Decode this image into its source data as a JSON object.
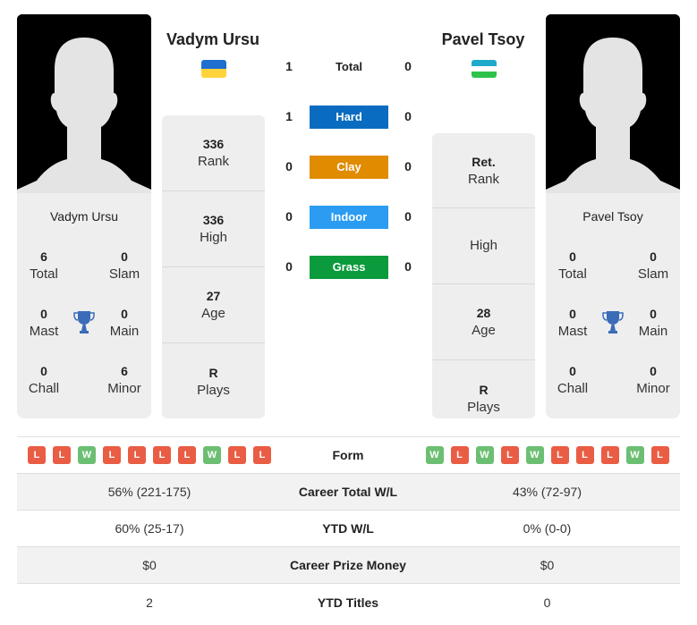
{
  "colors": {
    "hard": "#0a6cc0",
    "clay": "#e08b00",
    "indoor": "#2b9cf2",
    "grass": "#0b9a3c",
    "win": "#6cbf72",
    "loss": "#e95d44",
    "trophy": "#3a6cb8"
  },
  "player1": {
    "name": "Vadym Ursu",
    "flag": "ukraine-flag",
    "card_name": "Vadym Ursu",
    "titles": {
      "total": {
        "value": "6",
        "label": "Total"
      },
      "slam": {
        "value": "0",
        "label": "Slam"
      },
      "mast": {
        "value": "0",
        "label": "Mast"
      },
      "main": {
        "value": "0",
        "label": "Main"
      },
      "chall": {
        "value": "0",
        "label": "Chall"
      },
      "minor": {
        "value": "6",
        "label": "Minor"
      }
    },
    "stats": [
      {
        "value": "336",
        "label": "Rank"
      },
      {
        "value": "336",
        "label": "High"
      },
      {
        "value": "27",
        "label": "Age"
      },
      {
        "value": "R",
        "label": "Plays"
      }
    ],
    "form": [
      "L",
      "L",
      "W",
      "L",
      "L",
      "L",
      "L",
      "W",
      "L",
      "L"
    ]
  },
  "player2": {
    "name": "Pavel Tsoy",
    "flag": "uzbekistan-flag",
    "card_name": "Pavel Tsoy",
    "titles": {
      "total": {
        "value": "0",
        "label": "Total"
      },
      "slam": {
        "value": "0",
        "label": "Slam"
      },
      "mast": {
        "value": "0",
        "label": "Mast"
      },
      "main": {
        "value": "0",
        "label": "Main"
      },
      "chall": {
        "value": "0",
        "label": "Chall"
      },
      "minor": {
        "value": "0",
        "label": "Minor"
      }
    },
    "stats": [
      {
        "value": "Ret.",
        "label": "Rank"
      },
      {
        "value": "",
        "label": "High"
      },
      {
        "value": "28",
        "label": "Age"
      },
      {
        "value": "R",
        "label": "Plays"
      }
    ],
    "form": [
      "W",
      "L",
      "W",
      "L",
      "W",
      "L",
      "L",
      "L",
      "W",
      "L"
    ]
  },
  "h2h": [
    {
      "label": "Total",
      "p1": "1",
      "p2": "0",
      "type": "total"
    },
    {
      "label": "Hard",
      "p1": "1",
      "p2": "0",
      "type": "hard"
    },
    {
      "label": "Clay",
      "p1": "0",
      "p2": "0",
      "type": "clay"
    },
    {
      "label": "Indoor",
      "p1": "0",
      "p2": "0",
      "type": "indoor"
    },
    {
      "label": "Grass",
      "p1": "0",
      "p2": "0",
      "type": "grass"
    }
  ],
  "comparison": {
    "form_label": "Form",
    "rows": [
      {
        "label": "Career Total W/L",
        "p1": "56% (221-175)",
        "p2": "43% (72-97)"
      },
      {
        "label": "YTD W/L",
        "p1": "60% (25-17)",
        "p2": "0% (0-0)"
      },
      {
        "label": "Career Prize Money",
        "p1": "$0",
        "p2": "$0"
      },
      {
        "label": "YTD Titles",
        "p1": "2",
        "p2": "0"
      }
    ]
  }
}
